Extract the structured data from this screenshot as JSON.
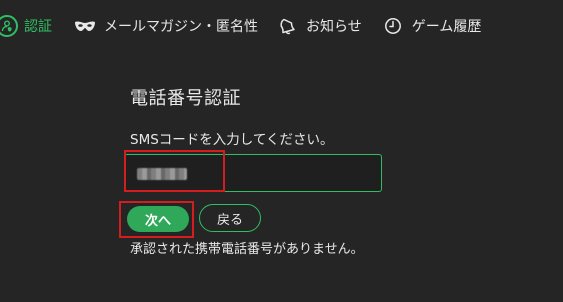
{
  "nav": {
    "items": [
      {
        "label": "認証",
        "icon": "user-shield-icon",
        "active": true
      },
      {
        "label": "メールマガジン・匿名性",
        "icon": "mask-icon",
        "active": false
      },
      {
        "label": "お知らせ",
        "icon": "bell-icon",
        "active": false
      },
      {
        "label": "ゲーム履歴",
        "icon": "clock-icon",
        "active": false
      }
    ]
  },
  "form": {
    "title": "電話番号認証",
    "description": "SMSコードを入力してください。",
    "input_placeholder": "",
    "next_label": "次へ",
    "back_label": "戻る",
    "status_message": "承認された携帯電話番号がありません。"
  },
  "colors": {
    "accent": "#2fbf62",
    "button_fill": "#2fa85a",
    "background": "#252525",
    "highlight": "#d21e1e"
  }
}
